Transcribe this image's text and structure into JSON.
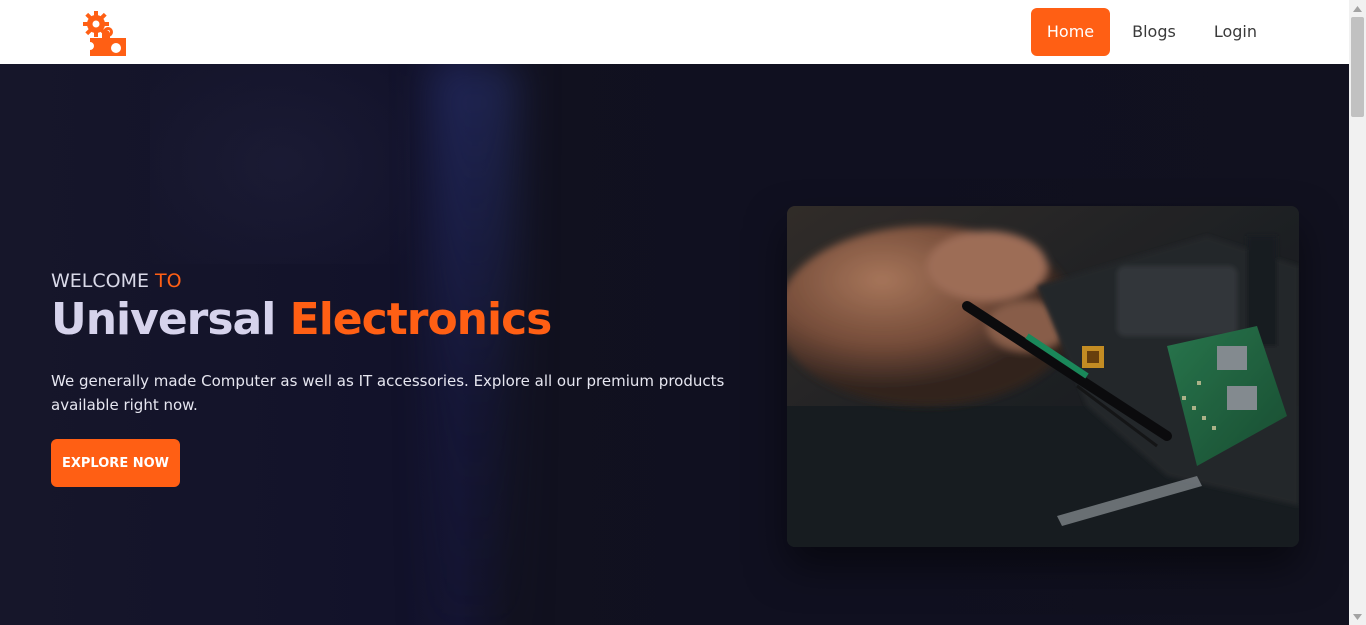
{
  "nav": {
    "logo_icon": "gear-puzzle-logo",
    "items": [
      {
        "label": "Home",
        "active": true
      },
      {
        "label": "Blogs",
        "active": false
      },
      {
        "label": "Login",
        "active": false
      }
    ]
  },
  "hero": {
    "welcome": "WELCOME",
    "welcome_accent": "TO",
    "title": "Universal",
    "title_accent": "Electronics",
    "description": "We generally made Computer as well as IT accessories. Explore all our premium products available right now.",
    "cta_label": "EXPLORE NOW",
    "image_subject": "hands-repairing-circuit-board"
  },
  "colors": {
    "accent": "#ff5f14",
    "hero_bg": "#121222",
    "nav_bg": "#ffffff"
  }
}
